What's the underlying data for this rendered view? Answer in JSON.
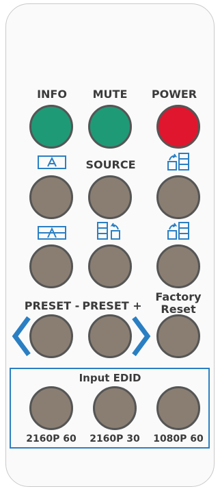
{
  "labels": {
    "info": "INFO",
    "mute": "MUTE",
    "power": "POWER",
    "source": "SOURCE",
    "preset_minus": "PRESET -",
    "preset_plus": "PRESET +",
    "factory_line1": "Factory",
    "factory_line2": "Reset"
  },
  "edid": {
    "title": "Input EDID",
    "btn1": "2160P 60",
    "btn2": "2160P 30",
    "btn3": "1080P 60"
  },
  "icons": {
    "a_box": "letter-a-box-icon",
    "a_strike": "letter-a-strikethrough-box-icon",
    "layout_arrow_left": "layout-arrow-left-icon",
    "layout_arrow_right": "layout-arrow-right-icon",
    "left_arrow": "left-chevron-arrow-icon",
    "right_arrow": "right-chevron-arrow-icon"
  },
  "colors": {
    "green": "#1f9a76",
    "red": "#e0162e",
    "taupe": "#8a7e73",
    "blue": "#2a7fc3"
  }
}
